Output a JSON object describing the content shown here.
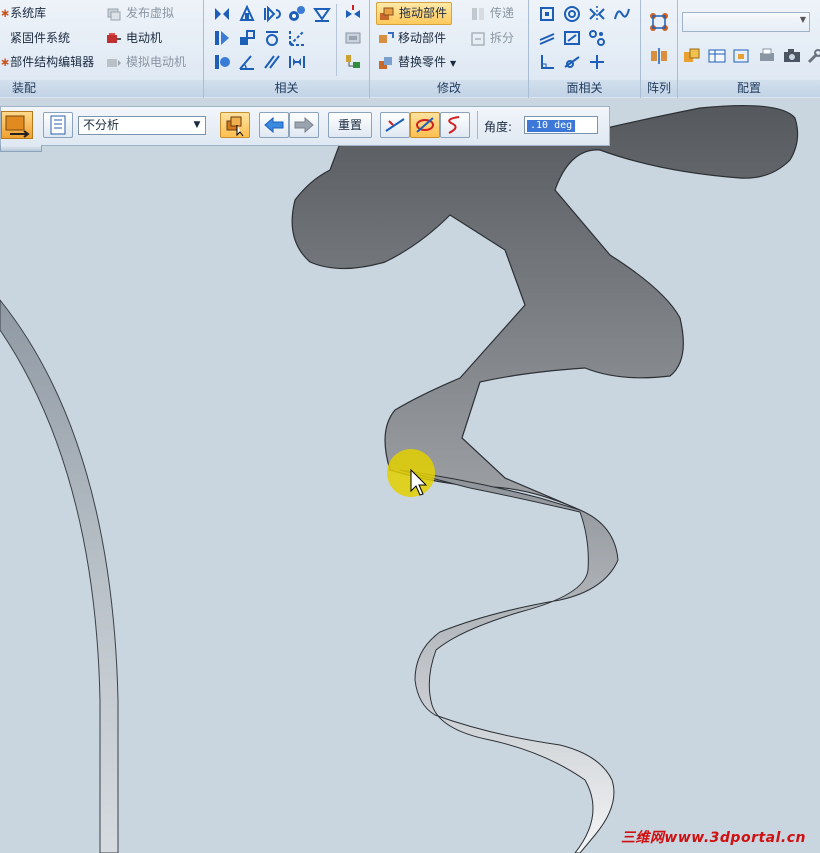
{
  "ribbon": {
    "assembly": {
      "label": "装配",
      "items": [
        "系统库",
        "紧固件系统",
        "部件结构编辑器"
      ],
      "right_items": [
        "发布虚拟",
        "电动机",
        "模拟电动机"
      ]
    },
    "relations": {
      "label": "相关"
    },
    "modify": {
      "label": "修改",
      "items": [
        "拖动部件",
        "移动部件",
        "替换零件"
      ],
      "right_items": [
        "传递",
        "拆分"
      ]
    },
    "face_relations": {
      "label": "面相关"
    },
    "pattern": {
      "label": "阵列"
    },
    "config": {
      "label": "配置"
    }
  },
  "command_bar": {
    "analysis_select": "不分析",
    "reset_label": "重置",
    "angle_label": "角度:",
    "angle_value": ".10 deg"
  },
  "watermark": "三维网www.3dportal.cn",
  "colors": {
    "viewport_bg": "#c9d5df",
    "gear_dark": "#5f6367",
    "highlight": "#e3d000"
  }
}
